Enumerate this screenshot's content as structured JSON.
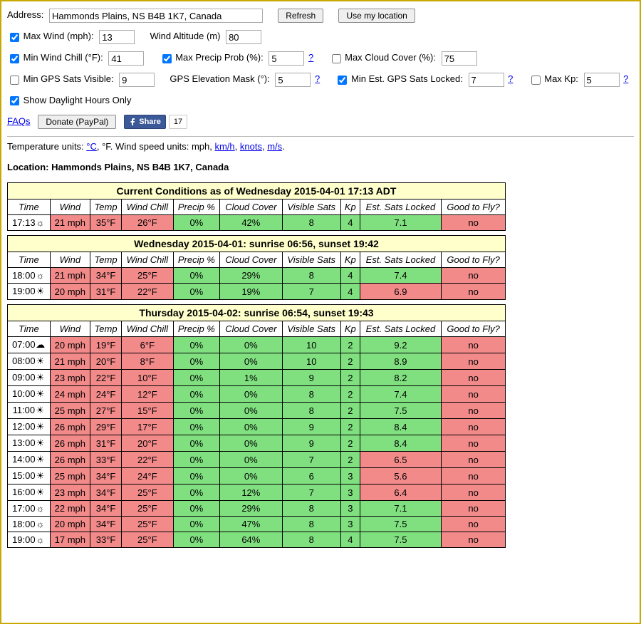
{
  "address": {
    "label": "Address:",
    "value": "Hammonds Plains, NS B4B 1K7, Canada",
    "refresh": "Refresh",
    "useLocation": "Use my location"
  },
  "filters": {
    "maxWind": {
      "label": "Max Wind (mph):",
      "value": "13",
      "checked": true
    },
    "windAlt": {
      "label": "Wind Altitude (m)",
      "value": "80"
    },
    "minChill": {
      "label": "Min Wind Chill (°F):",
      "value": "41",
      "checked": true
    },
    "maxPrecip": {
      "label": "Max Precip Prob (%):",
      "value": "5",
      "checked": true
    },
    "maxCloud": {
      "label": "Max Cloud Cover (%):",
      "value": "75",
      "checked": false
    },
    "minSats": {
      "label": "Min GPS Sats Visible:",
      "value": "9",
      "checked": false
    },
    "elevMask": {
      "label": "GPS Elevation Mask (°):",
      "value": "5"
    },
    "minLocked": {
      "label": "Min Est. GPS Sats Locked:",
      "value": "7",
      "checked": true
    },
    "maxKp": {
      "label": "Max Kp:",
      "value": "5",
      "checked": false
    },
    "daylight": {
      "label": "Show Daylight Hours Only",
      "checked": true
    }
  },
  "links": {
    "faqs": "FAQs",
    "donate": "Donate (PayPal)",
    "share": "Share",
    "shareCount": "17",
    "q": "?"
  },
  "units": {
    "text1": "Temperature units: ",
    "c": "°C",
    "fsep": ", °F. Wind speed units: mph, ",
    "kmh": "km/h",
    "sep1": ", ",
    "knots": "knots",
    "sep2": ", ",
    "ms": "m/s",
    "dot": "."
  },
  "locationLine": "Location: Hammonds Plains, NS B4B 1K7, Canada",
  "headers": [
    "Time",
    "Wind",
    "Temp",
    "Wind Chill",
    "Precip %",
    "Cloud Cover",
    "Visible Sats",
    "Kp",
    "Est. Sats Locked",
    "Good to Fly?"
  ],
  "icons": {
    "sun": "☀",
    "psun": "☼",
    "cloud": "☁"
  },
  "chart_data": [
    {
      "type": "table",
      "title": "Current Conditions as of Wednesday 2015-04-01 17:13 ADT",
      "columns": [
        "Time",
        "Wind",
        "Temp",
        "Wind Chill",
        "Precip %",
        "Cloud Cover",
        "Visible Sats",
        "Kp",
        "Est. Sats Locked",
        "Good to Fly?"
      ],
      "rows": [
        {
          "time": "17:13",
          "icon": "psun",
          "wind": "21 mph",
          "temp": "35°F",
          "chill": "26°F",
          "precip": "0%",
          "cloud": "42%",
          "sats": "8",
          "kp": "4",
          "locked": "7.1",
          "good": "no",
          "c": {
            "wind": "bad",
            "temp": "bad",
            "chill": "bad",
            "precip": "ok",
            "cloud": "ok",
            "sats": "ok",
            "kp": "ok",
            "locked": "ok",
            "good": "bad"
          }
        }
      ]
    },
    {
      "type": "table",
      "title": "Wednesday 2015-04-01: sunrise 06:56, sunset 19:42",
      "columns": [
        "Time",
        "Wind",
        "Temp",
        "Wind Chill",
        "Precip %",
        "Cloud Cover",
        "Visible Sats",
        "Kp",
        "Est. Sats Locked",
        "Good to Fly?"
      ],
      "rows": [
        {
          "time": "18:00",
          "icon": "psun",
          "wind": "21 mph",
          "temp": "34°F",
          "chill": "25°F",
          "precip": "0%",
          "cloud": "29%",
          "sats": "8",
          "kp": "4",
          "locked": "7.4",
          "good": "no",
          "c": {
            "wind": "bad",
            "temp": "bad",
            "chill": "bad",
            "precip": "ok",
            "cloud": "ok",
            "sats": "ok",
            "kp": "ok",
            "locked": "ok",
            "good": "bad"
          }
        },
        {
          "time": "19:00",
          "icon": "sun",
          "wind": "20 mph",
          "temp": "31°F",
          "chill": "22°F",
          "precip": "0%",
          "cloud": "19%",
          "sats": "7",
          "kp": "4",
          "locked": "6.9",
          "good": "no",
          "c": {
            "wind": "bad",
            "temp": "bad",
            "chill": "bad",
            "precip": "ok",
            "cloud": "ok",
            "sats": "ok",
            "kp": "ok",
            "locked": "bad",
            "good": "bad"
          }
        }
      ]
    },
    {
      "type": "table",
      "title": "Thursday 2015-04-02: sunrise 06:54, sunset 19:43",
      "columns": [
        "Time",
        "Wind",
        "Temp",
        "Wind Chill",
        "Precip %",
        "Cloud Cover",
        "Visible Sats",
        "Kp",
        "Est. Sats Locked",
        "Good to Fly?"
      ],
      "rows": [
        {
          "time": "07:00",
          "icon": "cloud",
          "wind": "20 mph",
          "temp": "19°F",
          "chill": "6°F",
          "precip": "0%",
          "cloud": "0%",
          "sats": "10",
          "kp": "2",
          "locked": "9.2",
          "good": "no",
          "c": {
            "wind": "bad",
            "temp": "bad",
            "chill": "bad",
            "precip": "ok",
            "cloud": "ok",
            "sats": "ok",
            "kp": "ok",
            "locked": "ok",
            "good": "bad"
          }
        },
        {
          "time": "08:00",
          "icon": "sun",
          "wind": "21 mph",
          "temp": "20°F",
          "chill": "8°F",
          "precip": "0%",
          "cloud": "0%",
          "sats": "10",
          "kp": "2",
          "locked": "8.9",
          "good": "no",
          "c": {
            "wind": "bad",
            "temp": "bad",
            "chill": "bad",
            "precip": "ok",
            "cloud": "ok",
            "sats": "ok",
            "kp": "ok",
            "locked": "ok",
            "good": "bad"
          }
        },
        {
          "time": "09:00",
          "icon": "sun",
          "wind": "23 mph",
          "temp": "22°F",
          "chill": "10°F",
          "precip": "0%",
          "cloud": "1%",
          "sats": "9",
          "kp": "2",
          "locked": "8.2",
          "good": "no",
          "c": {
            "wind": "bad",
            "temp": "bad",
            "chill": "bad",
            "precip": "ok",
            "cloud": "ok",
            "sats": "ok",
            "kp": "ok",
            "locked": "ok",
            "good": "bad"
          }
        },
        {
          "time": "10:00",
          "icon": "sun",
          "wind": "24 mph",
          "temp": "24°F",
          "chill": "12°F",
          "precip": "0%",
          "cloud": "0%",
          "sats": "8",
          "kp": "2",
          "locked": "7.4",
          "good": "no",
          "c": {
            "wind": "bad",
            "temp": "bad",
            "chill": "bad",
            "precip": "ok",
            "cloud": "ok",
            "sats": "ok",
            "kp": "ok",
            "locked": "ok",
            "good": "bad"
          }
        },
        {
          "time": "11:00",
          "icon": "sun",
          "wind": "25 mph",
          "temp": "27°F",
          "chill": "15°F",
          "precip": "0%",
          "cloud": "0%",
          "sats": "8",
          "kp": "2",
          "locked": "7.5",
          "good": "no",
          "c": {
            "wind": "bad",
            "temp": "bad",
            "chill": "bad",
            "precip": "ok",
            "cloud": "ok",
            "sats": "ok",
            "kp": "ok",
            "locked": "ok",
            "good": "bad"
          }
        },
        {
          "time": "12:00",
          "icon": "sun",
          "wind": "26 mph",
          "temp": "29°F",
          "chill": "17°F",
          "precip": "0%",
          "cloud": "0%",
          "sats": "9",
          "kp": "2",
          "locked": "8.4",
          "good": "no",
          "c": {
            "wind": "bad",
            "temp": "bad",
            "chill": "bad",
            "precip": "ok",
            "cloud": "ok",
            "sats": "ok",
            "kp": "ok",
            "locked": "ok",
            "good": "bad"
          }
        },
        {
          "time": "13:00",
          "icon": "sun",
          "wind": "26 mph",
          "temp": "31°F",
          "chill": "20°F",
          "precip": "0%",
          "cloud": "0%",
          "sats": "9",
          "kp": "2",
          "locked": "8.4",
          "good": "no",
          "c": {
            "wind": "bad",
            "temp": "bad",
            "chill": "bad",
            "precip": "ok",
            "cloud": "ok",
            "sats": "ok",
            "kp": "ok",
            "locked": "ok",
            "good": "bad"
          }
        },
        {
          "time": "14:00",
          "icon": "sun",
          "wind": "26 mph",
          "temp": "33°F",
          "chill": "22°F",
          "precip": "0%",
          "cloud": "0%",
          "sats": "7",
          "kp": "2",
          "locked": "6.5",
          "good": "no",
          "c": {
            "wind": "bad",
            "temp": "bad",
            "chill": "bad",
            "precip": "ok",
            "cloud": "ok",
            "sats": "ok",
            "kp": "ok",
            "locked": "bad",
            "good": "bad"
          }
        },
        {
          "time": "15:00",
          "icon": "sun",
          "wind": "25 mph",
          "temp": "34°F",
          "chill": "24°F",
          "precip": "0%",
          "cloud": "0%",
          "sats": "6",
          "kp": "3",
          "locked": "5.6",
          "good": "no",
          "c": {
            "wind": "bad",
            "temp": "bad",
            "chill": "bad",
            "precip": "ok",
            "cloud": "ok",
            "sats": "ok",
            "kp": "ok",
            "locked": "bad",
            "good": "bad"
          }
        },
        {
          "time": "16:00",
          "icon": "sun",
          "wind": "23 mph",
          "temp": "34°F",
          "chill": "25°F",
          "precip": "0%",
          "cloud": "12%",
          "sats": "7",
          "kp": "3",
          "locked": "6.4",
          "good": "no",
          "c": {
            "wind": "bad",
            "temp": "bad",
            "chill": "bad",
            "precip": "ok",
            "cloud": "ok",
            "sats": "ok",
            "kp": "ok",
            "locked": "bad",
            "good": "bad"
          }
        },
        {
          "time": "17:00",
          "icon": "psun",
          "wind": "22 mph",
          "temp": "34°F",
          "chill": "25°F",
          "precip": "0%",
          "cloud": "29%",
          "sats": "8",
          "kp": "3",
          "locked": "7.1",
          "good": "no",
          "c": {
            "wind": "bad",
            "temp": "bad",
            "chill": "bad",
            "precip": "ok",
            "cloud": "ok",
            "sats": "ok",
            "kp": "ok",
            "locked": "ok",
            "good": "bad"
          }
        },
        {
          "time": "18:00",
          "icon": "psun",
          "wind": "20 mph",
          "temp": "34°F",
          "chill": "25°F",
          "precip": "0%",
          "cloud": "47%",
          "sats": "8",
          "kp": "3",
          "locked": "7.5",
          "good": "no",
          "c": {
            "wind": "bad",
            "temp": "bad",
            "chill": "bad",
            "precip": "ok",
            "cloud": "ok",
            "sats": "ok",
            "kp": "ok",
            "locked": "ok",
            "good": "bad"
          }
        },
        {
          "time": "19:00",
          "icon": "psun",
          "wind": "17 mph",
          "temp": "33°F",
          "chill": "25°F",
          "precip": "0%",
          "cloud": "64%",
          "sats": "8",
          "kp": "4",
          "locked": "7.5",
          "good": "no",
          "c": {
            "wind": "bad",
            "temp": "bad",
            "chill": "bad",
            "precip": "ok",
            "cloud": "ok",
            "sats": "ok",
            "kp": "ok",
            "locked": "ok",
            "good": "bad"
          }
        }
      ]
    }
  ]
}
